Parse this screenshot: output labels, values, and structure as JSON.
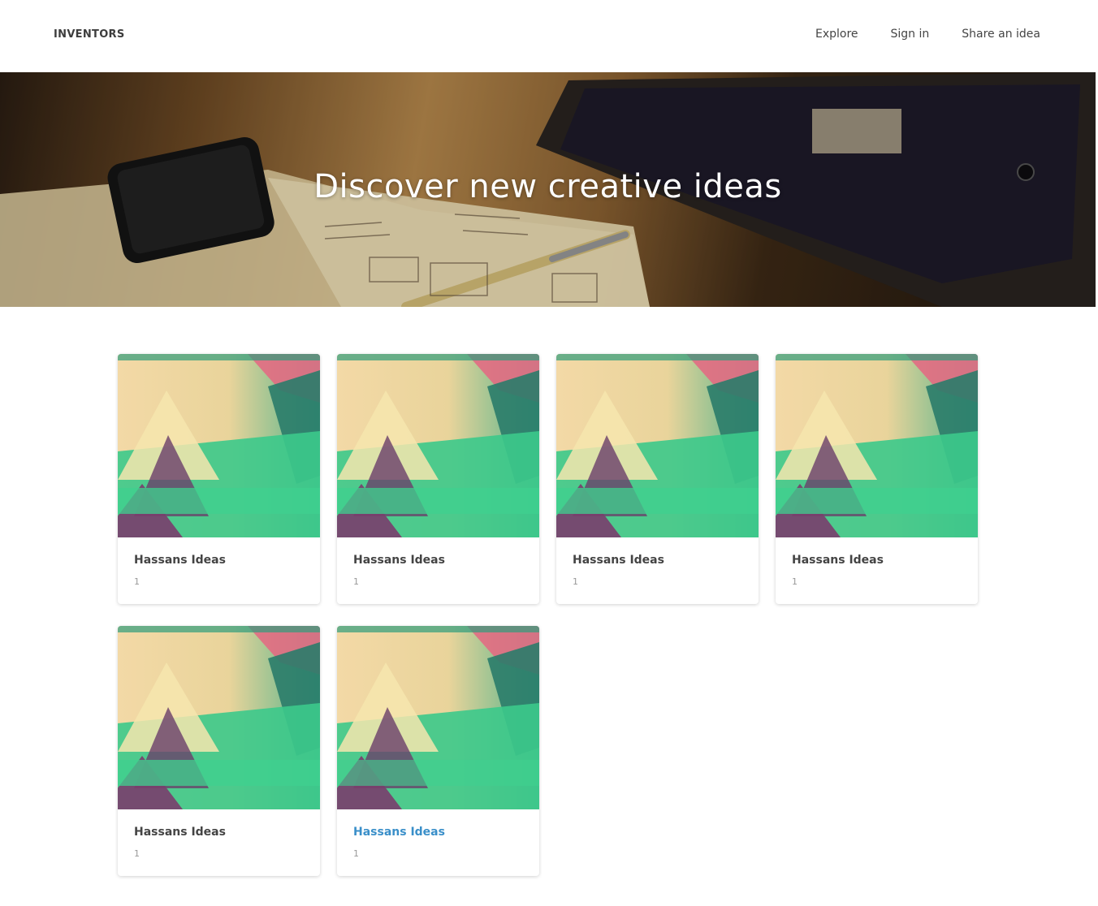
{
  "navbar": {
    "brand": "INVENTORS",
    "links": [
      {
        "label": "Explore"
      },
      {
        "label": "Sign in"
      },
      {
        "label": "Share an idea"
      }
    ]
  },
  "hero": {
    "title": "Discover new creative ideas"
  },
  "cards": [
    {
      "title": "Hassans Ideas",
      "count": "1"
    },
    {
      "title": "Hassans Ideas",
      "count": "1"
    },
    {
      "title": "Hassans Ideas",
      "count": "1"
    },
    {
      "title": "Hassans Ideas",
      "count": "1"
    },
    {
      "title": "Hassans Ideas",
      "count": "1"
    },
    {
      "title": "Hassans Ideas",
      "count": "1",
      "active": true
    }
  ],
  "colors": {
    "link_active": "#3a8fc9",
    "text": "#444444"
  }
}
